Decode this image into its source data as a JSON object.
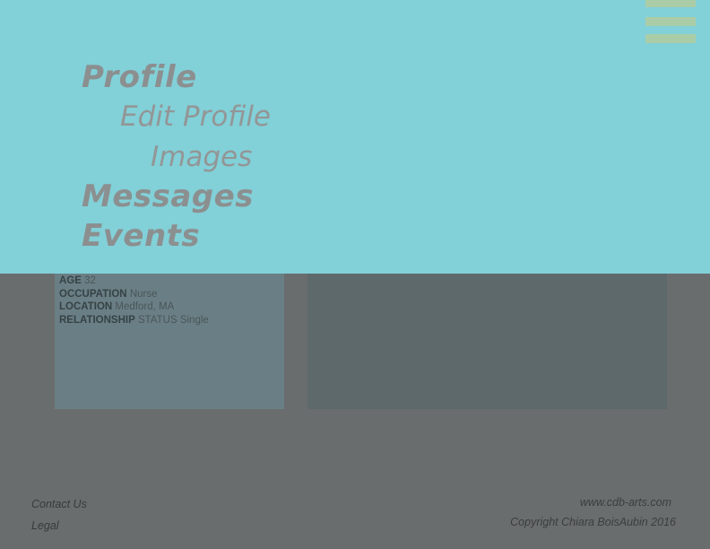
{
  "menu": {
    "items": [
      {
        "label": "Profile"
      },
      {
        "label": "Edit Profile"
      },
      {
        "label": "Images"
      },
      {
        "label": "Messages"
      },
      {
        "label": "Events"
      }
    ]
  },
  "profile": {
    "fields": [
      {
        "label": "AGE",
        "value": "32"
      },
      {
        "label": "OCCUPATION",
        "value": "Nurse"
      },
      {
        "label": "LOCATION",
        "value": "Medford, MA"
      },
      {
        "label": "RELATIONSHIP",
        "value": "STATUS Single"
      }
    ]
  },
  "footer": {
    "contact": "Contact Us",
    "legal": "Legal",
    "website": "www.cdb-arts.com",
    "copyright": "Copyright Chiara BoisAubin 2016"
  },
  "colors": {
    "menu_bg": "#82d0d8",
    "menu_text": "#8c8f8f",
    "hamburger": "#aacda8",
    "page_bg": "#6a6d6d"
  },
  "icons": {
    "menu": "hamburger-menu-icon"
  }
}
